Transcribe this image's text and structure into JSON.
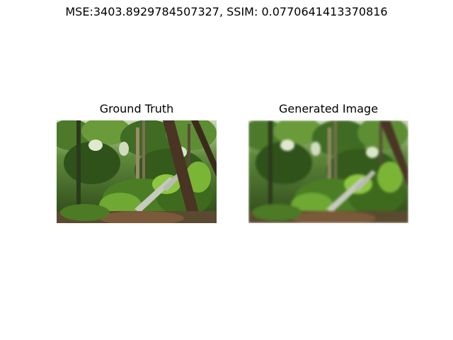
{
  "figure": {
    "suptitle": "MSE:3403.8929784507327, SSIM: 0.0770641413370816"
  },
  "panels": [
    {
      "title": "Ground Truth",
      "image_subject": "mossy forest with rocks and tree trunks"
    },
    {
      "title": "Generated Image",
      "image_subject": "mossy forest with rocks and tree trunks (blurred)"
    }
  ],
  "colors": {
    "background": "#ffffff",
    "foliage_dark": "#1f3a12",
    "foliage_mid": "#3f6b22",
    "foliage_bright": "#8dc63f",
    "trunk": "#4a3424",
    "rock": "#b8bcb2"
  }
}
